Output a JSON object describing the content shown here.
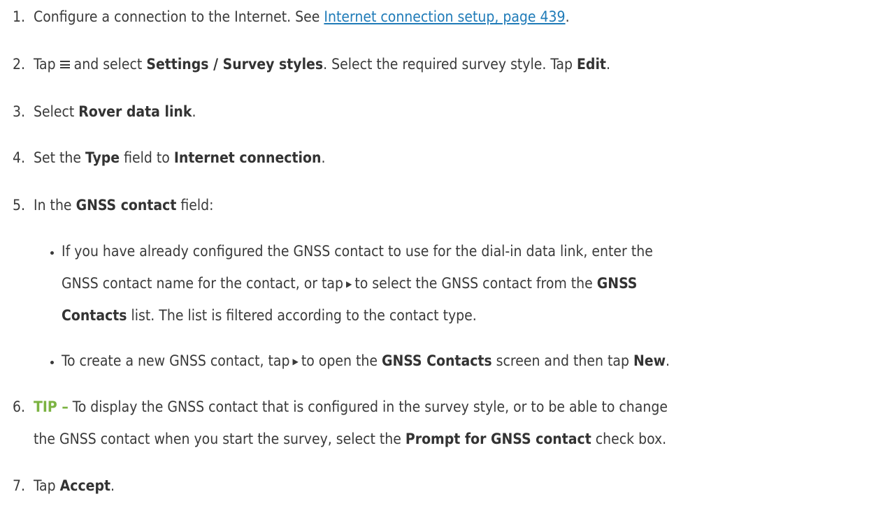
{
  "steps": [
    {
      "num": "1.",
      "text": "Configure a connection to the Internet. See ",
      "link": "Internet connection setup, page 439",
      "after": "."
    },
    {
      "num": "2.",
      "a": "Tap",
      "b": "and select",
      "c": "Settings",
      "d": " / ",
      "e": "Survey styles",
      "f": ". Select the required survey style. Tap ",
      "g": "Edit",
      "h": "."
    },
    {
      "num": "3.",
      "a": "Select ",
      "b": "Rover data link",
      "c": "."
    },
    {
      "num": "4.",
      "a": "Set the ",
      "b": "Type",
      "c": " field to ",
      "d": "Internet connection",
      "e": "."
    },
    {
      "num": "5.",
      "a": "In the ",
      "b": "GNSS contact",
      "c": " field:"
    },
    {
      "num": "6.",
      "tip": "TIP –",
      "a": " To display the GNSS contact that is configured in the survey style, or to be able to change",
      "b": "the GNSS contact when you start the survey, select the ",
      "c": "Prompt for GNSS contact",
      "d": " check box."
    },
    {
      "num": "7.",
      "a": "Tap ",
      "b": "Accept",
      "c": "."
    }
  ],
  "bullets": [
    {
      "l1": "If you have already configured the GNSS contact to use for the dial-in data link, enter the",
      "l2a": "GNSS contact name for the contact, or tap",
      "l2b": "to select the GNSS contact from the ",
      "l2c": "GNSS",
      "l3a": "Contacts",
      "l3b": " list. The list is filtered according to the contact type."
    },
    {
      "a": "To create a new GNSS contact, tap",
      "b": "to open the ",
      "c": "GNSS Contacts",
      "d": " screen and then tap ",
      "e": "New",
      "f": "."
    }
  ]
}
